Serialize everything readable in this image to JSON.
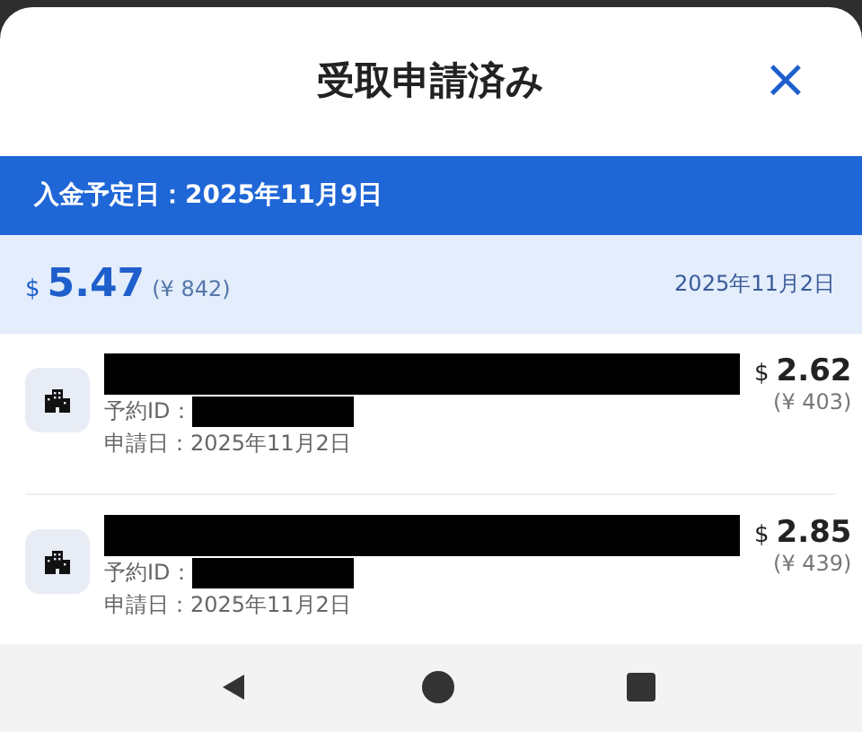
{
  "title": "受取申請済み",
  "close": "×",
  "payout_banner": "入金予定日：2025年11月9日",
  "summary": {
    "currency": "$",
    "amount": "5.47",
    "yen": "(¥ 842)",
    "date": "2025年11月2日"
  },
  "items": [
    {
      "kind": "hotel",
      "id_label": "予約ID：",
      "applied": "申請日：2025年11月2日",
      "currency": "$",
      "amount": "2.62",
      "yen": "(¥ 403)"
    },
    {
      "kind": "hotel",
      "id_label": "予約ID：",
      "applied": "申請日：2025年11月2日",
      "currency": "$",
      "amount": "2.85",
      "yen": "(¥ 439)"
    }
  ]
}
